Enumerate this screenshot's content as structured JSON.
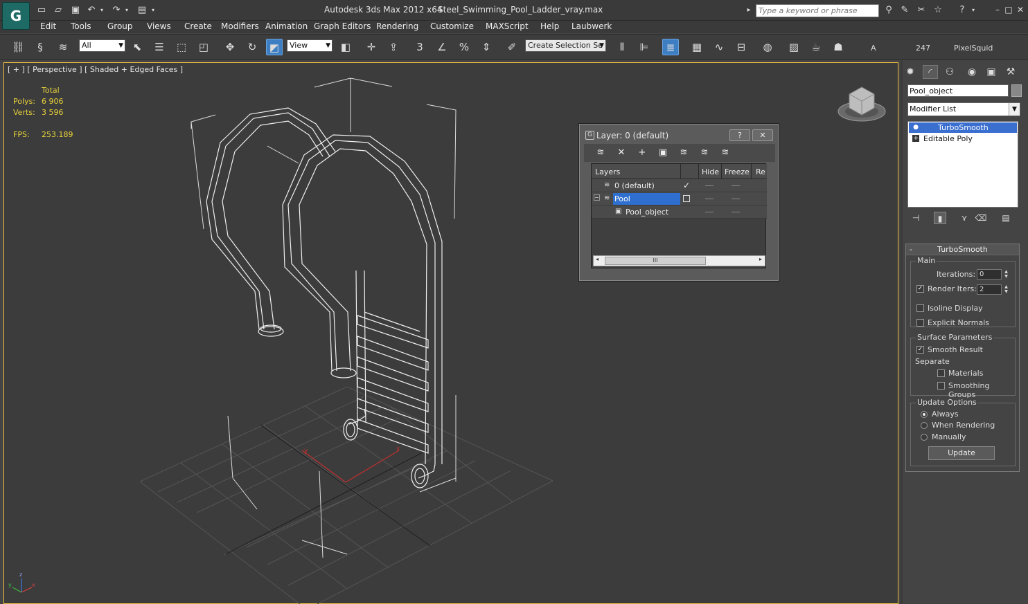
{
  "title": {
    "app": "Autodesk 3ds Max  2012 x64",
    "file": "Steel_Swimming_Pool_Ladder_vray.max",
    "search_placeholder": "Type a keyword or phrase"
  },
  "menu": [
    "Edit",
    "Tools",
    "Group",
    "Views",
    "Create",
    "Modifiers",
    "Animation",
    "Graph Editors",
    "Rendering",
    "Customize",
    "MAXScript",
    "Help",
    "Laubwerk"
  ],
  "toolbar": {
    "filter_value": "All",
    "refcoord_value": "View",
    "selection_set_value": "Create Selection Se",
    "label_a": "A",
    "label_count": "247",
    "label_user": "PixelSquid"
  },
  "viewport": {
    "label": "[ + ] [ Perspective ] [ Shaded + Edged Faces ]",
    "stats": {
      "total_label": "Total",
      "polys_label": "Polys:",
      "polys_value": "6 906",
      "verts_label": "Verts:",
      "verts_value": "3 596",
      "fps_label": "FPS:",
      "fps_value": "253.189"
    },
    "axis_x": "x",
    "axis_y": "y",
    "axis_z": "z"
  },
  "layer_dialog": {
    "title": "Layer: 0 (default)",
    "help_label": "?",
    "close_label": "✕",
    "columns": [
      "Layers",
      "Hide",
      "Freeze",
      "Re"
    ],
    "rows": [
      {
        "name": "0 (default)"
      },
      {
        "name": "Pool"
      },
      {
        "name": "Pool_object"
      }
    ],
    "scroll_thumb_label": "III"
  },
  "command_panel": {
    "object_name": "Pool_object",
    "modifier_list_label": "Modifier List",
    "stack": [
      "TurboSmooth",
      "Editable Poly"
    ],
    "rollout": {
      "title": "TurboSmooth",
      "main_label": "Main",
      "iterations_label": "Iterations:",
      "iterations_value": "0",
      "render_iters_label": "Render Iters:",
      "render_iters_value": "2",
      "isoline_label": "Isoline Display",
      "explicit_label": "Explicit Normals",
      "surface_label": "Surface Parameters",
      "smooth_result_label": "Smooth Result",
      "separate_label": "Separate",
      "materials_label": "Materials",
      "smoothing_groups_label": "Smoothing Groups",
      "update_options_label": "Update Options",
      "always_label": "Always",
      "when_rendering_label": "When Rendering",
      "manually_label": "Manually",
      "update_button_label": "Update"
    }
  },
  "colors": {
    "viewport_border": "#f0c040",
    "selection": "#2e6fd0",
    "stats_text": "#e8d23a"
  }
}
